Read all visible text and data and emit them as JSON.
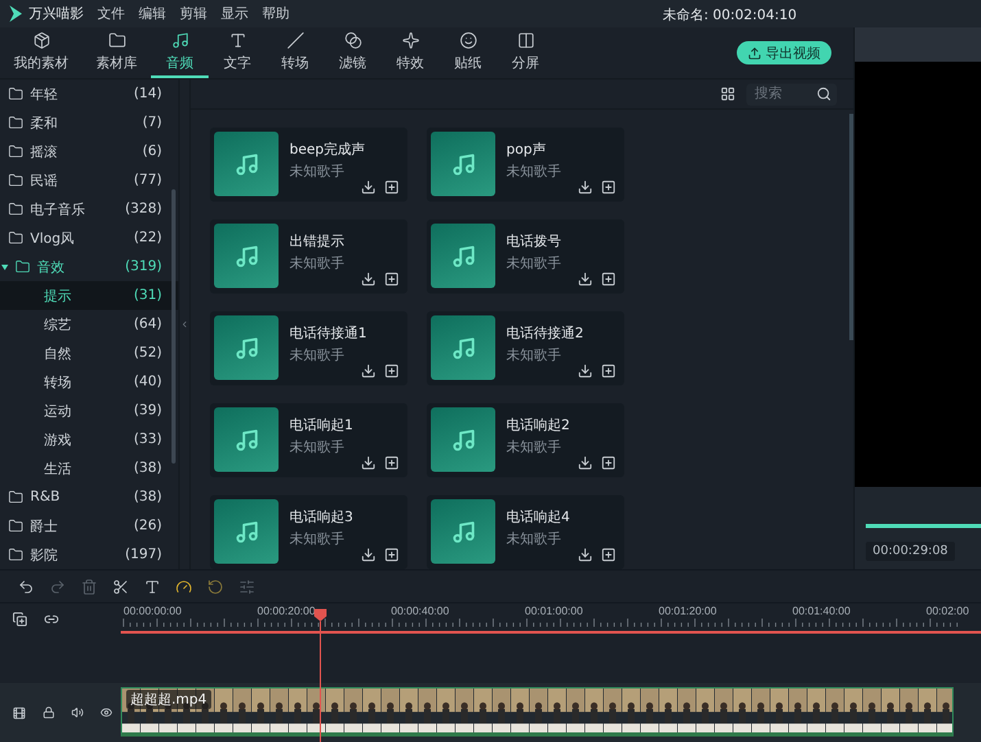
{
  "app": {
    "name": "万兴喵影",
    "menu": [
      "文件",
      "编辑",
      "剪辑",
      "显示",
      "帮助"
    ],
    "project_title": "未命名: 00:02:04:10"
  },
  "tabs": [
    {
      "kind": "media",
      "label": "我的素材",
      "selected": false
    },
    {
      "kind": "library",
      "label": "素材库",
      "selected": false
    },
    {
      "kind": "audio",
      "label": "音频",
      "selected": true
    },
    {
      "kind": "text",
      "label": "文字",
      "selected": false
    },
    {
      "kind": "transition",
      "label": "转场",
      "selected": false
    },
    {
      "kind": "filter",
      "label": "滤镜",
      "selected": false
    },
    {
      "kind": "effect",
      "label": "特效",
      "selected": false
    },
    {
      "kind": "sticker",
      "label": "贴纸",
      "selected": false
    },
    {
      "kind": "split",
      "label": "分屏",
      "selected": false
    }
  ],
  "export_button": "导出视频",
  "sidebar": [
    {
      "label": "年轻",
      "count": "(14)",
      "selected": false
    },
    {
      "label": "柔和",
      "count": "(7)",
      "selected": false
    },
    {
      "label": "摇滚",
      "count": "(6)",
      "selected": false
    },
    {
      "label": "民谣",
      "count": "(77)",
      "selected": false
    },
    {
      "label": "电子音乐",
      "count": "(328)",
      "selected": false
    },
    {
      "label": "Vlog风",
      "count": "(22)",
      "selected": false
    },
    {
      "label": "音效",
      "count": "(319)",
      "selected": false,
      "expanded": true,
      "children": [
        {
          "label": "提示",
          "count": "(31)",
          "selected": true
        },
        {
          "label": "综艺",
          "count": "(64)",
          "selected": false
        },
        {
          "label": "自然",
          "count": "(52)",
          "selected": false
        },
        {
          "label": "转场",
          "count": "(40)",
          "selected": false
        },
        {
          "label": "运动",
          "count": "(39)",
          "selected": false
        },
        {
          "label": "游戏",
          "count": "(33)",
          "selected": false
        },
        {
          "label": "生活",
          "count": "(38)",
          "selected": false
        }
      ]
    },
    {
      "label": "R&B",
      "count": "(38)",
      "selected": false
    },
    {
      "label": "爵士",
      "count": "(26)",
      "selected": false
    },
    {
      "label": "影院",
      "count": "(197)",
      "selected": false
    }
  ],
  "search": {
    "placeholder": "搜索"
  },
  "cards": [
    {
      "title": "beep完成声",
      "artist": "未知歌手"
    },
    {
      "title": "pop声",
      "artist": "未知歌手"
    },
    {
      "title": "出错提示",
      "artist": "未知歌手"
    },
    {
      "title": "电话拨号",
      "artist": "未知歌手"
    },
    {
      "title": "电话待接通1",
      "artist": "未知歌手"
    },
    {
      "title": "电话待接通2",
      "artist": "未知歌手"
    },
    {
      "title": "电话响起1",
      "artist": "未知歌手"
    },
    {
      "title": "电话响起2",
      "artist": "未知歌手"
    },
    {
      "title": "电话响起3",
      "artist": "未知歌手"
    },
    {
      "title": "电话响起4",
      "artist": "未知歌手"
    }
  ],
  "preview": {
    "time": "00:00:29:08"
  },
  "tools": [
    {
      "kind": "undo",
      "disabled": false,
      "highlighted": false
    },
    {
      "kind": "redo",
      "disabled": true,
      "highlighted": false
    },
    {
      "kind": "delete",
      "disabled": true,
      "highlighted": false
    },
    {
      "kind": "cut",
      "disabled": false,
      "highlighted": false
    },
    {
      "kind": "text",
      "disabled": false,
      "highlighted": false
    },
    {
      "kind": "speed",
      "disabled": false,
      "highlighted": true
    },
    {
      "kind": "reverse",
      "disabled": true,
      "highlighted": true
    },
    {
      "kind": "adjust",
      "disabled": true,
      "highlighted": false
    }
  ],
  "timeline": {
    "ruler": [
      "00:00:00:00",
      "00:00:20:00",
      "00:00:40:00",
      "00:01:00:00",
      "00:01:20:00",
      "00:01:40:00",
      "00:02:00"
    ],
    "clip": {
      "name": "超超超.mp4"
    }
  }
}
